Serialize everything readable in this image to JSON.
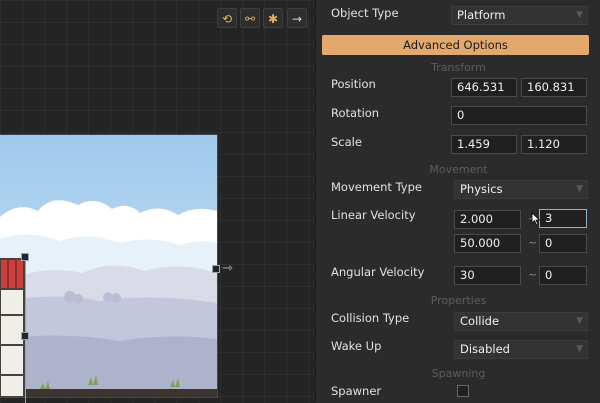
{
  "toolbar": {
    "icons": [
      "undo-icon",
      "link-icon",
      "bug-icon",
      "arrow-right-icon"
    ],
    "glyphs": [
      "⟲",
      "⚯",
      "✱",
      "→"
    ]
  },
  "inspector": {
    "object_type": {
      "label": "Object Type",
      "value": "Platform"
    },
    "advanced_options_label": "Advanced Options",
    "sections": {
      "transform": "Transform",
      "movement": "Movement",
      "properties": "Properties",
      "spawning": "Spawning"
    },
    "position": {
      "label": "Position",
      "x": "646.531",
      "y": "160.831"
    },
    "rotation": {
      "label": "Rotation",
      "value": "0"
    },
    "scale": {
      "label": "Scale",
      "x": "1.459",
      "y": "1.120"
    },
    "movement_type": {
      "label": "Movement Type",
      "value": "Physics"
    },
    "linear_velocity": {
      "label": "Linear Velocity",
      "x_value": "2.000",
      "x_range_end": "3",
      "y_value": "50.000",
      "y_range_end": "0",
      "separator": "~"
    },
    "angular_velocity": {
      "label": "Angular Velocity",
      "value": "30",
      "range_end": "0",
      "separator": "~"
    },
    "collision_type": {
      "label": "Collision Type",
      "value": "Collide"
    },
    "wake_up": {
      "label": "Wake Up",
      "value": "Disabled"
    },
    "spawner": {
      "label": "Spawner",
      "checked": false
    }
  },
  "colors": {
    "accent": "#e3a86c",
    "panel": "#2b2b2b",
    "field_focus": "#8fb4d6"
  }
}
